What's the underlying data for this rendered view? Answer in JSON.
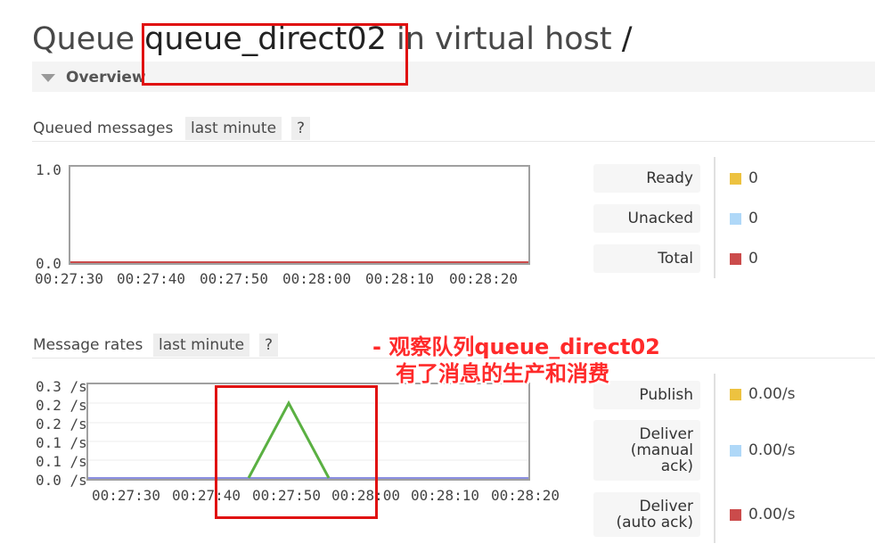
{
  "header": {
    "prefix": "Queue",
    "queue_name": "queue_direct02",
    "middle": "in virtual host",
    "vhost": "/",
    "overview_label": "Overview"
  },
  "queued": {
    "label": "Queued messages",
    "range": "last minute",
    "help": "?",
    "y_top": "1.0",
    "y_bottom": "0.0",
    "x_ticks": [
      "00:27:30",
      "00:27:40",
      "00:27:50",
      "00:28:00",
      "00:28:10",
      "00:28:20"
    ],
    "legend": [
      {
        "label": "Ready",
        "value": "0",
        "color": "#edc240"
      },
      {
        "label": "Unacked",
        "value": "0",
        "color": "#afd8f8"
      },
      {
        "label": "Total",
        "value": "0",
        "color": "#cb4b4b"
      }
    ]
  },
  "rates": {
    "label": "Message rates",
    "range": "last minute",
    "help": "?",
    "y_ticks": [
      "0.3 /s",
      "0.2 /s",
      "0.2 /s",
      "0.1 /s",
      "0.1 /s",
      "0.0 /s"
    ],
    "x_ticks": [
      "00:27:30",
      "00:27:40",
      "00:27:50",
      "00:28:00",
      "00:28:10",
      "00:28:20"
    ],
    "legend": {
      "publish": {
        "label": "Publish",
        "value": "0.00/s",
        "color": "#edc240"
      },
      "deliver_manual": {
        "line1": "Deliver",
        "line2": "(manual",
        "line3": "ack)",
        "value": "0.00/s",
        "color": "#afd8f8"
      },
      "deliver_auto": {
        "line1": "Deliver",
        "line2": "(auto ack)",
        "value": "0.00/s",
        "color": "#cb4b4b"
      }
    }
  },
  "annotation": {
    "line1": "- 观察队列queue_direct02",
    "line2": "有了消息的生产和消费"
  },
  "chart_data": [
    {
      "type": "line",
      "title": "Queued messages",
      "x": [
        "00:27:30",
        "00:27:40",
        "00:27:50",
        "00:28:00",
        "00:28:10",
        "00:28:20"
      ],
      "ylim": [
        0,
        1.0
      ],
      "series": [
        {
          "name": "Ready",
          "color": "#edc240",
          "values": [
            0,
            0,
            0,
            0,
            0,
            0
          ]
        },
        {
          "name": "Unacked",
          "color": "#afd8f8",
          "values": [
            0,
            0,
            0,
            0,
            0,
            0
          ]
        },
        {
          "name": "Total",
          "color": "#cb4b4b",
          "values": [
            0,
            0,
            0,
            0,
            0,
            0
          ]
        }
      ]
    },
    {
      "type": "line",
      "title": "Message rates",
      "x": [
        "00:27:30",
        "00:27:40",
        "00:27:50",
        "00:28:00",
        "00:28:10",
        "00:28:20"
      ],
      "ylim": [
        0,
        0.3
      ],
      "series": [
        {
          "name": "Publish",
          "color": "#5ab042",
          "points": [
            [
              "00:27:30",
              0
            ],
            [
              "00:27:45",
              0
            ],
            [
              "00:27:50",
              0.2
            ],
            [
              "00:27:55",
              0
            ],
            [
              "00:28:25",
              0
            ]
          ]
        },
        {
          "name": "Deliver (manual ack)",
          "color": "#8a8ee0",
          "points": [
            [
              "00:27:30",
              0
            ],
            [
              "00:28:25",
              0
            ]
          ]
        }
      ]
    }
  ]
}
